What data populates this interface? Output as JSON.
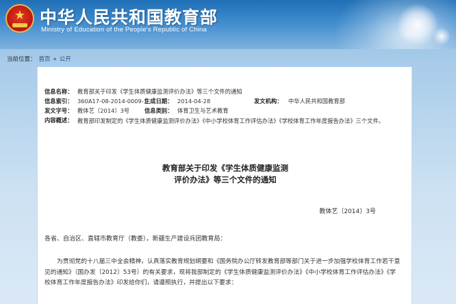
{
  "header": {
    "title_cn": "中华人民共和国教育部",
    "title_en": "Ministry of Education of the People's Republic of China",
    "emblem_icon": "national-emblem-icon"
  },
  "breadcrumb": {
    "prefix": "当前位置：",
    "home": "首页",
    "separator": "»",
    "section": "公开"
  },
  "meta": {
    "name_label": "信息名称：",
    "name_value": "教育部关于印发《学生体质健康监测评价办法》等三个文件的通知",
    "index_label": "信息索引：",
    "index_value": "360A17-08-2014-0009-1",
    "date_label": "生成日期：",
    "date_value": "2014-04-28",
    "issuer_label": "发文机构：",
    "issuer_value": "中华人民共和国教育部",
    "docno_label": "发文字号：",
    "docno_value": "教体艺〔2014〕3号",
    "category_label": "信息类别：",
    "category_value": "体育卫生与艺术教育",
    "summary_label": "内容概述：",
    "summary_value": "教育部印发制定的《学生体质健康监测评价办法》《中小学校体育工作评估办法》《学校体育工作年度报告办法》三个文件。"
  },
  "document": {
    "title_line1": "教育部关于印发《学生体质健康监测",
    "title_line2": "评价办法》等三个文件的通知",
    "number": "教体艺〔2014〕3号",
    "addressee": "各省、自治区、直辖市教育厅（教委），新疆生产建设兵团教育局：",
    "paragraph1": "为贯彻党的十八届三中全会精神，认真落实教育规划纲要和《国务院办公厅转发教育部等部门关于进一步加强学校体育工作若干意见的通知》（国办发〔2012〕53号）的有关要求，现将我部制定的《学生体质健康监测评价办法》《中小学校体育工作评估办法》《学校体育工作年度报告办法》印发给你们，请遵照执行，并提出以下要求："
  },
  "colors": {
    "header_blue": "#1f6fb6",
    "page_bg": "#a7cbe9",
    "link": "#2a4e7f"
  }
}
